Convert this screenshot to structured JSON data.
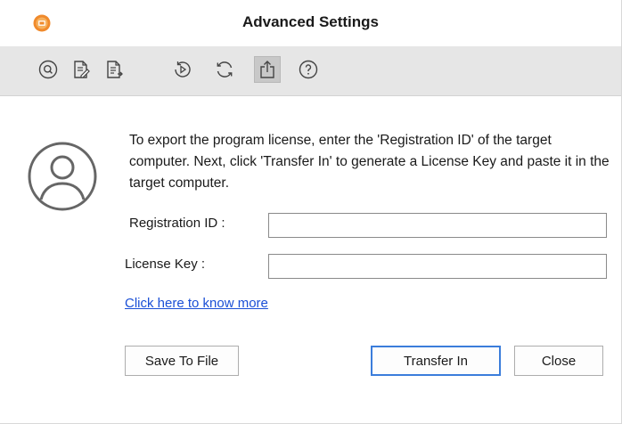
{
  "window": {
    "title": "Advanced Settings",
    "accent_color": "#3b7ddb",
    "app_icon": "orange-app-logo-icon"
  },
  "toolbar": {
    "items": [
      {
        "icon": "search-circle-icon",
        "active": false
      },
      {
        "icon": "document-edit-icon",
        "active": false
      },
      {
        "icon": "document-export-icon",
        "active": false
      },
      {
        "icon": "history-play-icon",
        "active": false
      },
      {
        "icon": "refresh-icon",
        "active": false
      },
      {
        "icon": "export-upload-icon",
        "active": true
      },
      {
        "icon": "help-icon",
        "active": false
      }
    ]
  },
  "main": {
    "avatar_icon": "user-avatar-icon",
    "description": "To export the program license, enter the 'Registration ID' of the target computer. Next, click 'Transfer In' to generate a License Key and paste it in the target computer.",
    "registration_label": "Registration ID :",
    "registration_value": "",
    "license_label": "License Key :",
    "license_value": "",
    "more_link": "Click here to know more",
    "save_button": "Save To File",
    "transfer_button": "Transfer In",
    "close_button": "Close"
  }
}
